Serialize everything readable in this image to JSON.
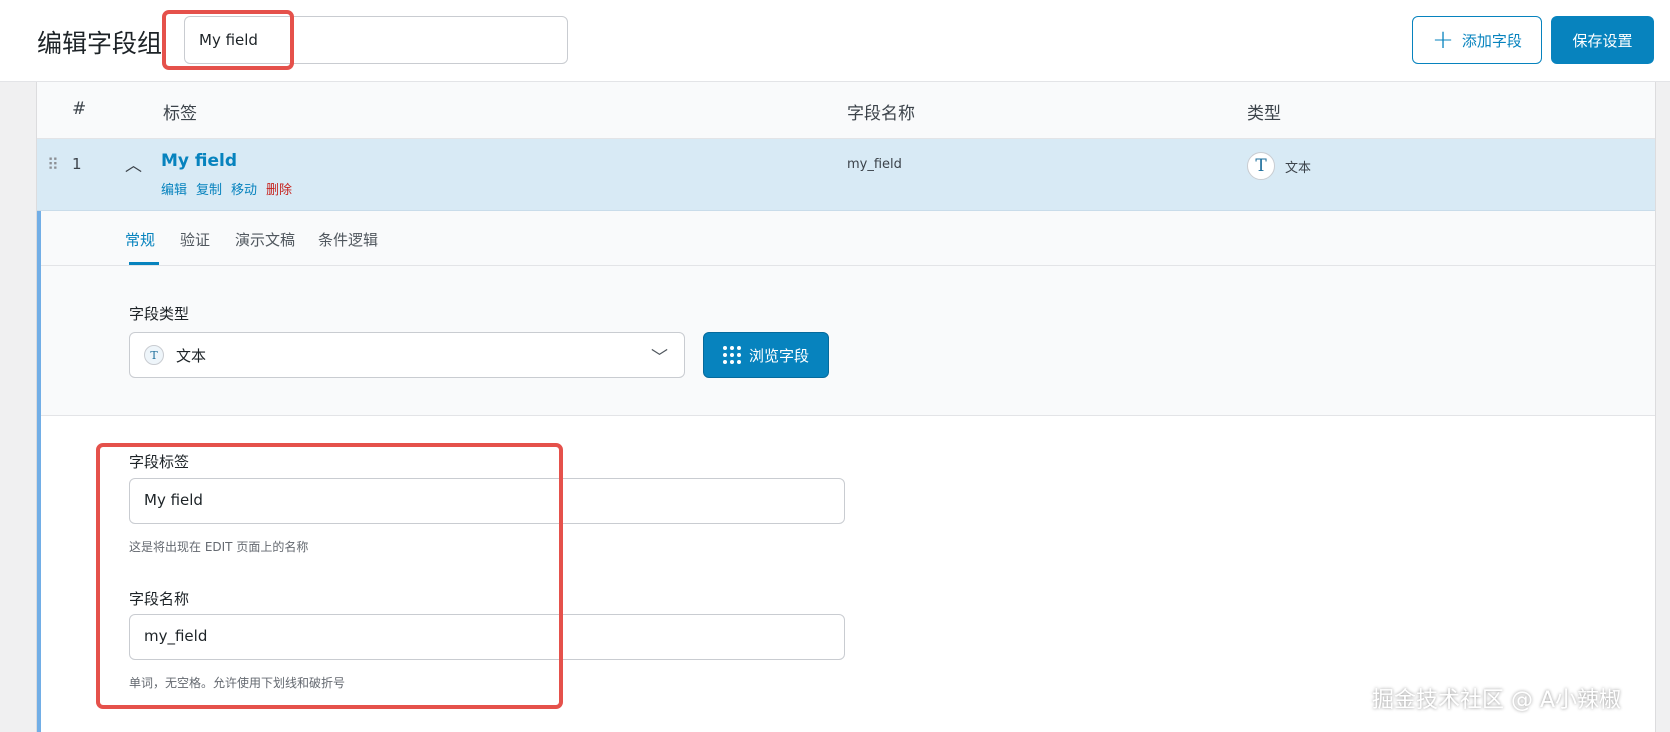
{
  "header": {
    "title": "编辑字段组",
    "group_title_value": "My field",
    "add_field_label": "添加字段",
    "save_label": "保存设置"
  },
  "table": {
    "columns": [
      "#",
      "标签",
      "字段名称",
      "类型"
    ]
  },
  "field_row": {
    "number": "1",
    "label": "My field",
    "actions": [
      "编辑",
      "复制",
      "移动",
      "删除"
    ],
    "name": "my_field",
    "type": "文本"
  },
  "tabs": [
    "常规",
    "验证",
    "演示文稿",
    "条件逻辑"
  ],
  "general": {
    "field_type_label": "字段类型",
    "field_type_value": "文本",
    "browse_label": "浏览字段",
    "field_label_title": "字段标签",
    "field_label_value": "My field",
    "field_label_hint": "这是将出现在 EDIT 页面上的名称",
    "field_name_title": "字段名称",
    "field_name_value": "my_field",
    "field_name_hint": "单词，无空格。允许使用下划线和破折号"
  },
  "watermark": "掘金技术社区 @ A小辣椒",
  "colors": {
    "accent": "#0783be",
    "highlight_box": "#e5514b",
    "row_selected": "#d8eaf5",
    "delete": "#c6241f"
  }
}
